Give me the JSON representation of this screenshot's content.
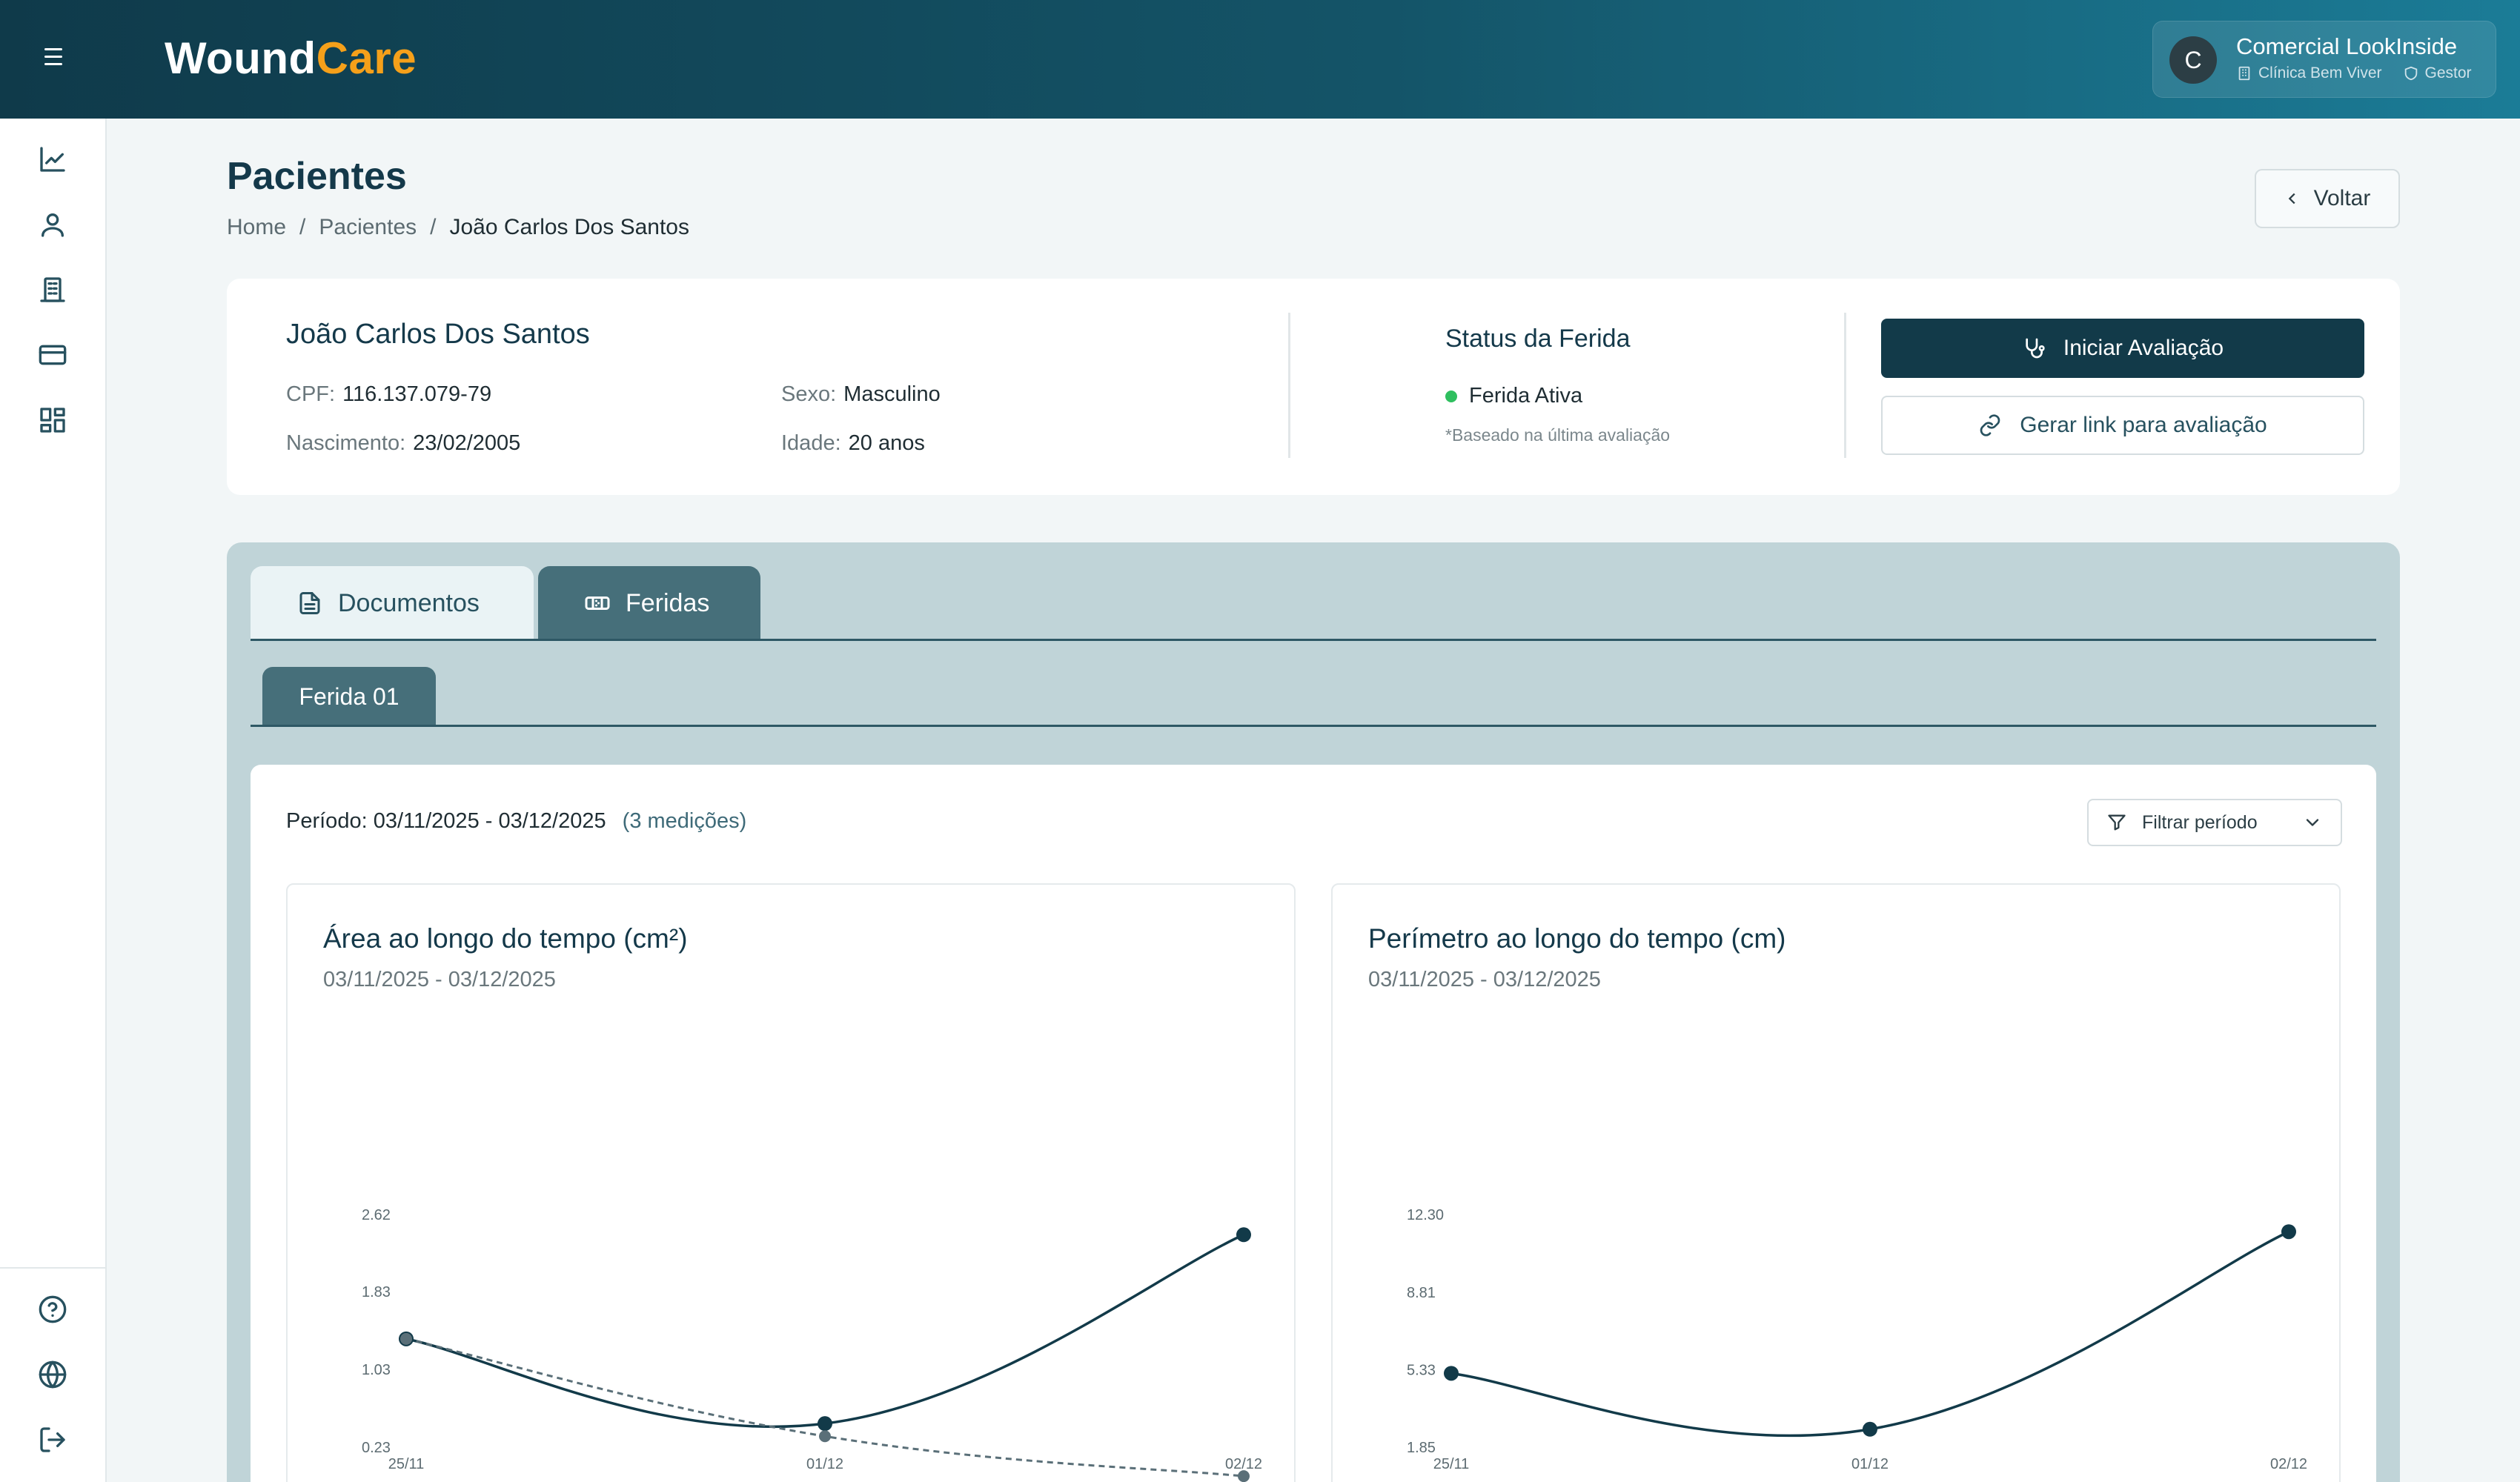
{
  "header": {
    "logo_part1": "Wound",
    "logo_part2": "Care",
    "user_initial": "C",
    "user_name": "Comercial LookInside",
    "clinic": "Clínica Bem Viver",
    "role": "Gestor"
  },
  "sidebar": {
    "items": [
      {
        "icon": "chart-line-icon"
      },
      {
        "icon": "user-icon"
      },
      {
        "icon": "building-icon"
      },
      {
        "icon": "credit-card-icon"
      },
      {
        "icon": "dashboard-grid-icon"
      }
    ],
    "bottom": [
      {
        "icon": "help-circle-icon"
      },
      {
        "icon": "globe-icon"
      },
      {
        "icon": "logout-icon"
      }
    ]
  },
  "page": {
    "title": "Pacientes",
    "breadcrumb": [
      "Home",
      "Pacientes",
      "João Carlos Dos Santos"
    ],
    "separator": "/",
    "back_label": "Voltar"
  },
  "patient": {
    "name": "João Carlos Dos Santos",
    "cpf_label": "CPF:",
    "cpf": "116.137.079-79",
    "birth_label": "Nascimento:",
    "birth": "23/02/2005",
    "sex_label": "Sexo:",
    "sex": "Masculino",
    "age_label": "Idade:",
    "age": "20 anos"
  },
  "status": {
    "title": "Status da Ferida",
    "value": "Ferida Ativa",
    "note": "*Baseado na última avaliação",
    "color": "#2fbf5f"
  },
  "actions": {
    "start": "Iniciar Avaliação",
    "link": "Gerar link para avaliação"
  },
  "tabs": [
    {
      "label": "Documentos",
      "icon": "document-icon",
      "active": false
    },
    {
      "label": "Feridas",
      "icon": "bandage-icon",
      "active": true
    }
  ],
  "subtabs": [
    {
      "label": "Ferida 01",
      "active": true
    }
  ],
  "period": {
    "label": "Período:",
    "range": "03/11/2025 - 03/12/2025",
    "count": "(3 medições)",
    "filter_label": "Filtrar período"
  },
  "colors": {
    "primary": "#123a49",
    "accent": "#f5a01a",
    "series": "#123a49",
    "trend": "#5a6f78"
  },
  "chart_data": [
    {
      "type": "line",
      "title": "Área ao longo do tempo (cm²)",
      "subtitle": "03/11/2025 - 03/12/2025",
      "categories": [
        "25/11",
        "01/12",
        "02/12"
      ],
      "yticks": [
        "2.62",
        "1.83",
        "1.03",
        "0.23"
      ],
      "ylim": [
        0.23,
        2.62
      ],
      "series": [
        {
          "values": [
            1.35,
            0.48,
            2.42
          ],
          "style": "solid"
        },
        {
          "values": [
            1.35,
            0.35,
            -0.06
          ],
          "style": "dashed"
        }
      ]
    },
    {
      "type": "line",
      "title": "Perímetro ao longo do tempo (cm)",
      "subtitle": "03/11/2025 - 03/12/2025",
      "categories": [
        "25/11",
        "01/12",
        "02/12"
      ],
      "yticks": [
        "12.30",
        "8.81",
        "5.33",
        "1.85"
      ],
      "ylim": [
        1.85,
        12.3
      ],
      "series": [
        {
          "values": [
            5.2,
            2.69,
            11.56
          ],
          "style": "solid"
        }
      ]
    }
  ]
}
